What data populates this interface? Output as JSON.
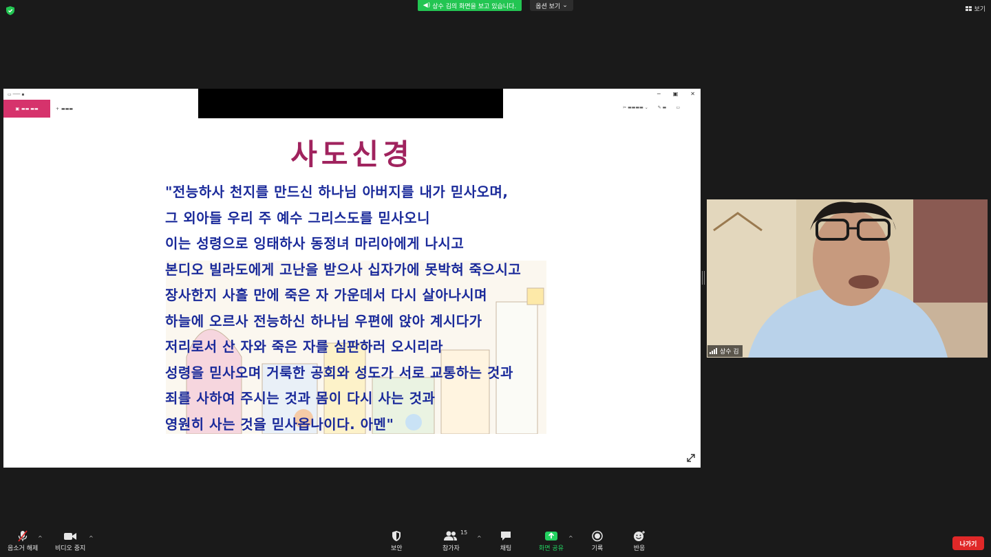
{
  "top_bar": {
    "share_banner": "상수 김의 화면을 보고 있습니다.",
    "view_options": "옵션 보기",
    "view_button": "보기",
    "colors": {
      "banner_green": "#23c552",
      "shield_green": "#23c552"
    }
  },
  "shared_screen": {
    "slide": {
      "title": "사도신경",
      "lines": [
        "\"전능하사 천지를 만드신 하나님 아버지를 내가 믿사오며,",
        "그 외아들 우리 주 예수 그리스도를 믿사오니",
        "이는 성령으로 잉태하사 동정녀 마리아에게 나시고",
        "본디오 빌라도에게 고난을 받으사 십자가에 못박혀 죽으시고",
        "장사한지 사흘 만에 죽은 자 가운데서 다시 살아나시며",
        "하늘에 오르사 전능하신 하나님 우편에 앉아 계시다가",
        "저리로서 산 자와 죽은 자를 심판하러 오시리라",
        "성령을 믿사오며 거룩한 공회와 성도가 서로 교통하는 것과",
        "죄를 사하여 주시는 것과 몸이 다시 사는 것과",
        "영원히 사는 것을 믿사옵나이다. 아멘\""
      ],
      "colors": {
        "title": "#a0235e",
        "text": "#1a2a9a"
      }
    }
  },
  "video": {
    "participant_name": "상수 김"
  },
  "toolbar": {
    "mute": "음소거 해제",
    "video": "비디오 중지",
    "security": "보안",
    "participants": "참가자",
    "participants_count": "15",
    "chat": "채팅",
    "share_screen": "화면 공유",
    "record": "기록",
    "reactions": "반응",
    "leave": "나가기",
    "colors": {
      "share_green": "#23d160",
      "leave_red": "#e02828"
    }
  }
}
